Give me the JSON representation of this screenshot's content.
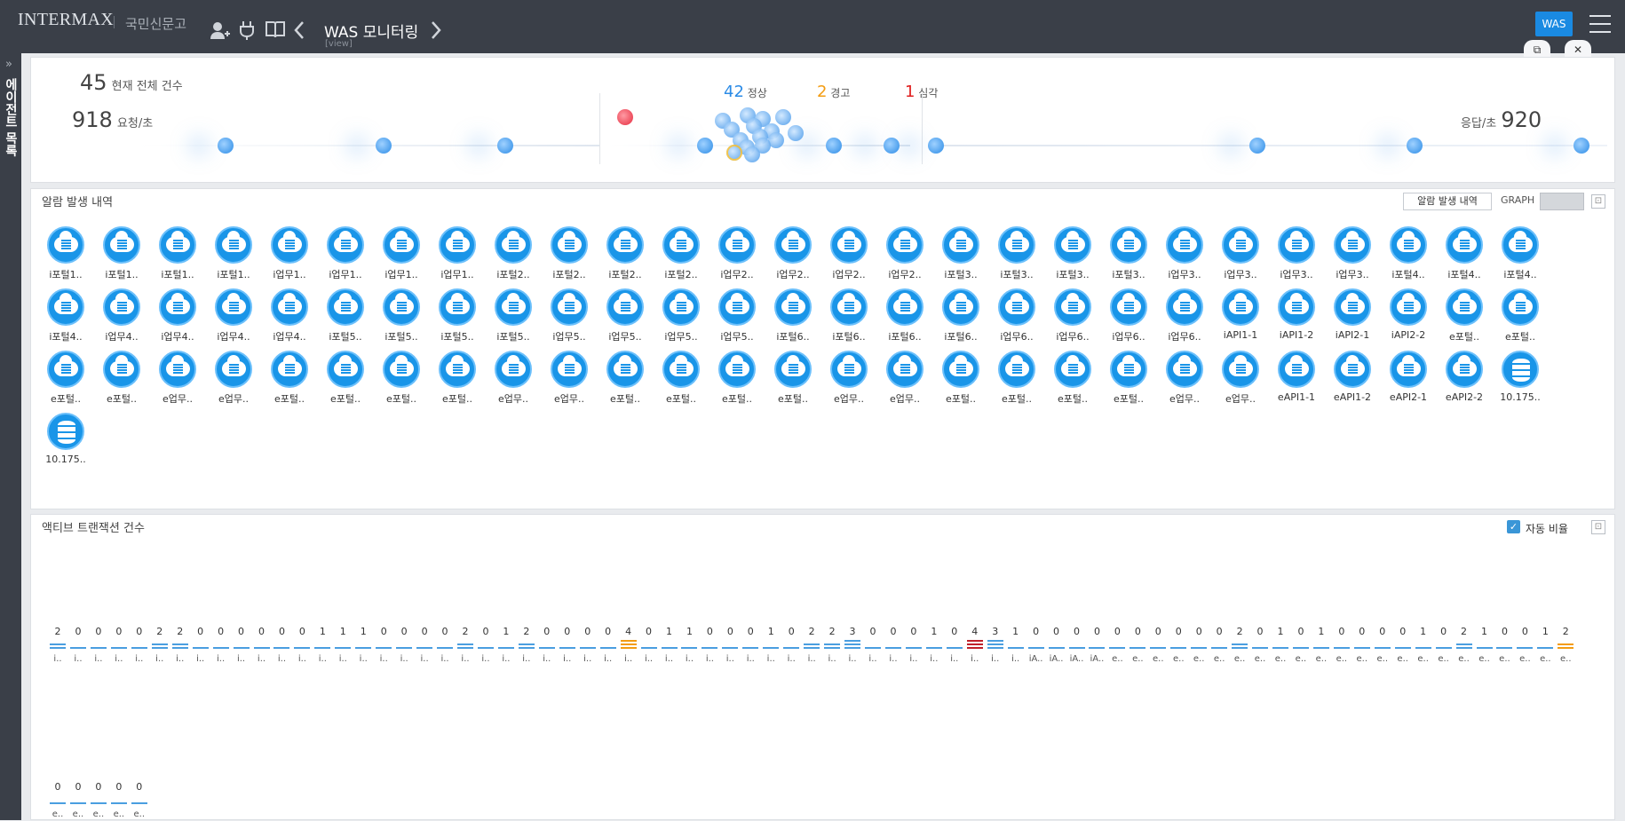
{
  "header": {
    "logo": "INTERMAX",
    "org": "국민신문고",
    "title": "WAS 모니터링",
    "subtitle": "[view]",
    "was_button": "WAS",
    "win_restore_icon": "restore-icon",
    "win_close_icon": "close-icon"
  },
  "sidebar": {
    "label": "에이전트 목록"
  },
  "summary": {
    "total_count": "45",
    "total_label": "현재 전체 건수",
    "requests": "918",
    "requests_label": "요청/초",
    "responses_label": "응답/초",
    "responses": "920",
    "normal_count": "42",
    "normal_label": "정상",
    "warning_count": "2",
    "warning_label": "경고",
    "critical_count": "1",
    "critical_label": "심각",
    "colors": {
      "normal": "#2b8be6",
      "warning": "#f39c12",
      "critical": "#e02020"
    }
  },
  "alarm_panel": {
    "title": "알람 발생 내역",
    "history_button": "알람 발생 내역",
    "graph_label": "GRAPH",
    "servers": [
      {
        "label": "i포털1..",
        "type": "cloud"
      },
      {
        "label": "i포털1..",
        "type": "cloud"
      },
      {
        "label": "i포털1..",
        "type": "cloud"
      },
      {
        "label": "i포털1..",
        "type": "cloud"
      },
      {
        "label": "i업무1..",
        "type": "cloud"
      },
      {
        "label": "i업무1..",
        "type": "cloud"
      },
      {
        "label": "i업무1..",
        "type": "cloud"
      },
      {
        "label": "i업무1..",
        "type": "cloud"
      },
      {
        "label": "i포털2..",
        "type": "cloud"
      },
      {
        "label": "i포털2..",
        "type": "cloud"
      },
      {
        "label": "i포털2..",
        "type": "cloud"
      },
      {
        "label": "i포털2..",
        "type": "cloud"
      },
      {
        "label": "i업무2..",
        "type": "cloud"
      },
      {
        "label": "i업무2..",
        "type": "cloud"
      },
      {
        "label": "i업무2..",
        "type": "cloud"
      },
      {
        "label": "i업무2..",
        "type": "cloud"
      },
      {
        "label": "i포털3..",
        "type": "cloud"
      },
      {
        "label": "i포털3..",
        "type": "cloud"
      },
      {
        "label": "i포털3..",
        "type": "cloud"
      },
      {
        "label": "i포털3..",
        "type": "cloud"
      },
      {
        "label": "i업무3..",
        "type": "cloud"
      },
      {
        "label": "i업무3..",
        "type": "cloud"
      },
      {
        "label": "i업무3..",
        "type": "cloud"
      },
      {
        "label": "i업무3..",
        "type": "cloud"
      },
      {
        "label": "i포털4..",
        "type": "cloud"
      },
      {
        "label": "i포털4..",
        "type": "cloud"
      },
      {
        "label": "i포털4..",
        "type": "cloud"
      },
      {
        "label": "i포털4..",
        "type": "cloud"
      },
      {
        "label": "i업무4..",
        "type": "cloud"
      },
      {
        "label": "i업무4..",
        "type": "cloud"
      },
      {
        "label": "i업무4..",
        "type": "cloud"
      },
      {
        "label": "i업무4..",
        "type": "cloud"
      },
      {
        "label": "i포털5..",
        "type": "cloud"
      },
      {
        "label": "i포털5..",
        "type": "cloud"
      },
      {
        "label": "i포털5..",
        "type": "cloud"
      },
      {
        "label": "i포털5..",
        "type": "cloud"
      },
      {
        "label": "i업무5..",
        "type": "cloud"
      },
      {
        "label": "i업무5..",
        "type": "cloud"
      },
      {
        "label": "i업무5..",
        "type": "cloud"
      },
      {
        "label": "i업무5..",
        "type": "cloud"
      },
      {
        "label": "i포털6..",
        "type": "cloud"
      },
      {
        "label": "i포털6..",
        "type": "cloud"
      },
      {
        "label": "i포털6..",
        "type": "cloud"
      },
      {
        "label": "i포털6..",
        "type": "cloud"
      },
      {
        "label": "i업무6..",
        "type": "cloud"
      },
      {
        "label": "i업무6..",
        "type": "cloud"
      },
      {
        "label": "i업무6..",
        "type": "cloud"
      },
      {
        "label": "i업무6..",
        "type": "cloud"
      },
      {
        "label": "iAPI1-1",
        "type": "cloud"
      },
      {
        "label": "iAPI1-2",
        "type": "cloud"
      },
      {
        "label": "iAPI2-1",
        "type": "cloud"
      },
      {
        "label": "iAPI2-2",
        "type": "cloud"
      },
      {
        "label": "e포털..",
        "type": "cloud"
      },
      {
        "label": "e포털..",
        "type": "cloud"
      },
      {
        "label": "e포털..",
        "type": "cloud"
      },
      {
        "label": "e포털..",
        "type": "cloud"
      },
      {
        "label": "e업무..",
        "type": "cloud"
      },
      {
        "label": "e업무..",
        "type": "cloud"
      },
      {
        "label": "e포털..",
        "type": "cloud"
      },
      {
        "label": "e포털..",
        "type": "cloud"
      },
      {
        "label": "e포털..",
        "type": "cloud"
      },
      {
        "label": "e포털..",
        "type": "cloud"
      },
      {
        "label": "e업무..",
        "type": "cloud"
      },
      {
        "label": "e업무..",
        "type": "cloud"
      },
      {
        "label": "e포털..",
        "type": "cloud"
      },
      {
        "label": "e포털..",
        "type": "cloud"
      },
      {
        "label": "e포털..",
        "type": "cloud"
      },
      {
        "label": "e포털..",
        "type": "cloud"
      },
      {
        "label": "e업무..",
        "type": "cloud"
      },
      {
        "label": "e업무..",
        "type": "cloud"
      },
      {
        "label": "e포털..",
        "type": "cloud"
      },
      {
        "label": "e포털..",
        "type": "cloud"
      },
      {
        "label": "e포털..",
        "type": "cloud"
      },
      {
        "label": "e포털..",
        "type": "cloud"
      },
      {
        "label": "e업무..",
        "type": "cloud"
      },
      {
        "label": "e업무..",
        "type": "cloud"
      },
      {
        "label": "eAPI1-1",
        "type": "cloud"
      },
      {
        "label": "eAPI1-2",
        "type": "cloud"
      },
      {
        "label": "eAPI2-1",
        "type": "cloud"
      },
      {
        "label": "eAPI2-2",
        "type": "cloud"
      },
      {
        "label": "10.175..",
        "type": "db"
      },
      {
        "label": "10.175..",
        "type": "db"
      }
    ]
  },
  "active_panel": {
    "title": "액티브 트랜잭션 건수",
    "auto_ratio_label": "자동 비율",
    "auto_ratio_checked": true,
    "row1": {
      "values": [
        2,
        0,
        0,
        0,
        0,
        2,
        2,
        0,
        0,
        0,
        0,
        0,
        0,
        1,
        1,
        1,
        0,
        0,
        0,
        0,
        2,
        0,
        1,
        2,
        0,
        0,
        0,
        0,
        4,
        0,
        1,
        1,
        0,
        0,
        0,
        1,
        0,
        2,
        2,
        3,
        0,
        0,
        0,
        1,
        0,
        4,
        3,
        1,
        0,
        0,
        0,
        0,
        0,
        0,
        0,
        0,
        0,
        0,
        2,
        0,
        1,
        0,
        1,
        0,
        0,
        0,
        0,
        1,
        0,
        2,
        1,
        0,
        0,
        1,
        2
      ],
      "labels": [
        "i..",
        "i..",
        "i..",
        "i..",
        "i..",
        "i..",
        "i..",
        "i..",
        "i..",
        "i..",
        "i..",
        "i..",
        "i..",
        "i..",
        "i..",
        "i..",
        "i..",
        "i..",
        "i..",
        "i..",
        "i..",
        "i..",
        "i..",
        "i..",
        "i..",
        "i..",
        "i..",
        "i..",
        "i..",
        "i..",
        "i..",
        "i..",
        "i..",
        "i..",
        "i..",
        "i..",
        "i..",
        "i..",
        "i..",
        "i..",
        "i..",
        "i..",
        "i..",
        "i..",
        "i..",
        "i..",
        "i..",
        "i..",
        "iA..",
        "iA..",
        "iA..",
        "iA..",
        "e..",
        "e..",
        "e..",
        "e..",
        "e..",
        "e..",
        "e..",
        "e..",
        "e..",
        "e..",
        "e..",
        "e..",
        "e..",
        "e..",
        "e..",
        "e..",
        "e..",
        "e..",
        "e..",
        "e..",
        "e..",
        "e..",
        "e.."
      ],
      "status": {
        "28": "warning",
        "45": "critical",
        "74": "warning"
      }
    },
    "row2": {
      "values": [
        0,
        0,
        0,
        0,
        0
      ],
      "labels": [
        "e..",
        "e..",
        "e..",
        "e..",
        "e.."
      ]
    }
  }
}
